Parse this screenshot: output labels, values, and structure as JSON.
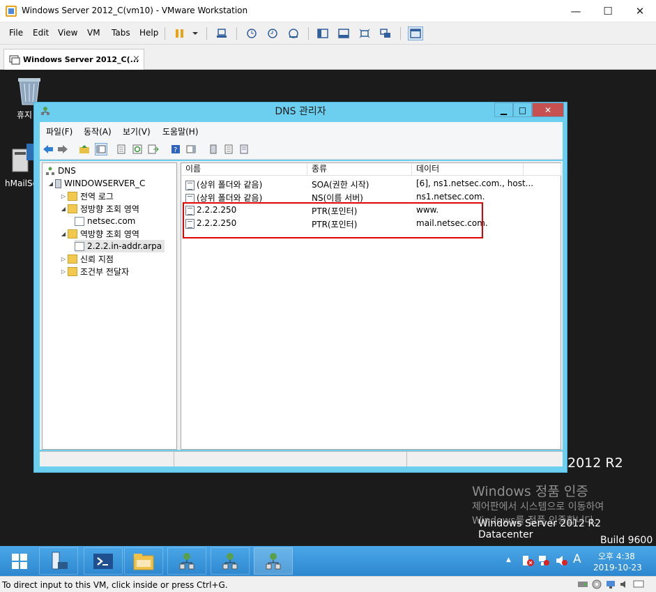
{
  "vmware": {
    "window_title": "Windows Server 2012_C(vm10) - VMware Workstation",
    "controls": {
      "minimize": "—",
      "maximize": "☐",
      "close": "✕"
    },
    "menu": [
      "File",
      "Edit",
      "View",
      "VM",
      "Tabs",
      "Help"
    ],
    "tab_label": "Windows Server 2012_C(...",
    "tab_close": "×",
    "status_text": "To direct input to this VM, click inside or press Ctrl+G."
  },
  "desktop": {
    "recycle_label": "휴지",
    "hmail_label": "hMailSe",
    "watermark": {
      "r2": "2012 R2",
      "activate_title": "Windows 정품 인증",
      "activate_line1": "제어판에서 시스템으로 이동하여",
      "activate_line2": "Windows를 정품 인증합니다.",
      "edition": "Windows Server 2012 R2 Datacenter",
      "build": "Build 9600"
    }
  },
  "dns_manager": {
    "title": "DNS 관리자",
    "controls": {
      "minimize": "▁",
      "maximize": "□",
      "close": "✕"
    },
    "menu": [
      "파일(F)",
      "동작(A)",
      "보기(V)",
      "도움말(H)"
    ],
    "tree": {
      "root": "DNS",
      "server": "WINDOWSERVER_C",
      "global_log": "전역 로그",
      "forward_zones": "정방향 조회 영역",
      "forward_zone_1": "netsec.com",
      "reverse_zones": "역방향 조회 영역",
      "reverse_zone_1": "2.2.2.in-addr.arpa",
      "trust_points": "신뢰 지점",
      "conditional_forwarders": "조건부 전달자"
    },
    "columns": [
      "이름",
      "종류",
      "데이터"
    ],
    "records": [
      {
        "name": "(상위 폴더와 같음)",
        "type": "SOA(권한 시작)",
        "data": "[6], ns1.netsec.com., host..."
      },
      {
        "name": "(상위 폴더와 같음)",
        "type": "NS(이름 서버)",
        "data": "ns1.netsec.com."
      },
      {
        "name": "2.2.2.250",
        "type": "PTR(포인터)",
        "data": "www."
      },
      {
        "name": "2.2.2.250",
        "type": "PTR(포인터)",
        "data": "mail.netsec.com."
      }
    ]
  },
  "taskbar": {
    "clock_time": "오후 4:38",
    "clock_date": "2019-10-23",
    "ime": "A",
    "tray_up": "▲"
  }
}
